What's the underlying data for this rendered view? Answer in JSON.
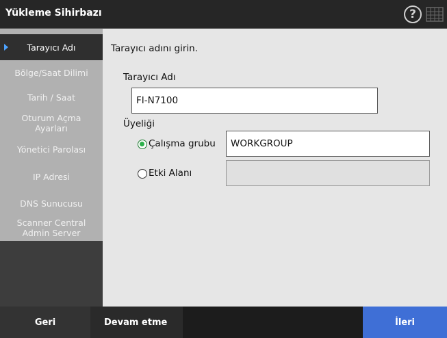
{
  "window": {
    "title": "Yükleme Sihirbazı"
  },
  "header_icons": {
    "help": "help-icon",
    "keyboard": "keyboard-icon",
    "help_glyph": "?"
  },
  "sidebar": {
    "items": [
      {
        "label": "Tarayıcı Adı",
        "active": true
      },
      {
        "label": "Bölge/Saat Dilimi"
      },
      {
        "label": "Tarih / Saat"
      },
      {
        "label": "Oturum Açma Ayarları"
      },
      {
        "label": "Yönetici Parolası"
      },
      {
        "label": "IP Adresi"
      },
      {
        "label": "DNS Sunucusu"
      },
      {
        "label": "Scanner Central Admin Server"
      }
    ]
  },
  "main": {
    "instruction": "Tarayıcı adını girin.",
    "scanner_name_label": "Tarayıcı Adı",
    "scanner_name_value": "FI-N7100",
    "membership_label": "Üyeliği",
    "workgroup_label": "Çalışma grubu",
    "workgroup_value": "WORKGROUP",
    "domain_label": "Etki Alanı",
    "domain_value": ""
  },
  "footer": {
    "back_label": "Geri",
    "continue_label": "Devam etme",
    "next_label": "İleri"
  },
  "colors": {
    "accent": "#3f6fd6",
    "radio_selected": "#2bb14a",
    "active_arrow": "#4da3ff"
  }
}
